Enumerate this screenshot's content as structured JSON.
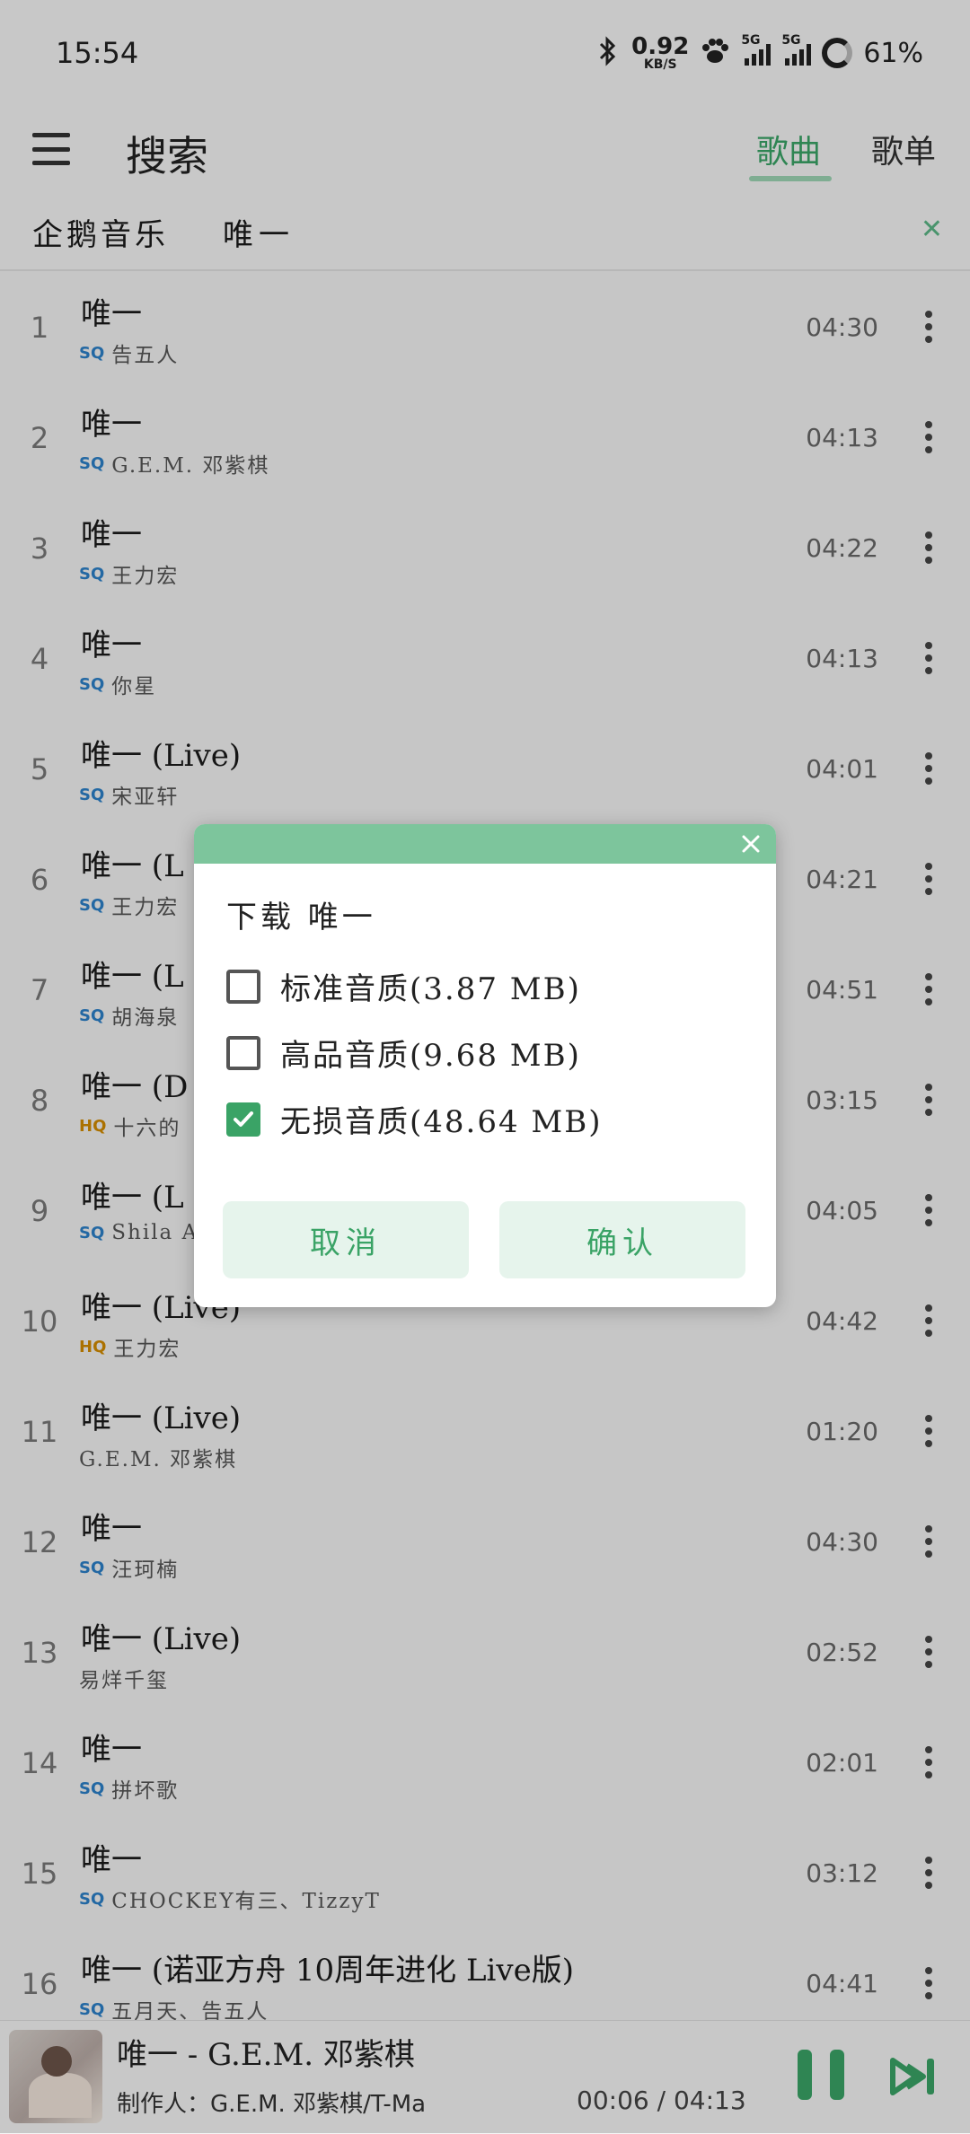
{
  "status_bar": {
    "time": "15:54",
    "net_speed_value": "0.92",
    "net_speed_unit": "KB/S",
    "signal1_label": "5G",
    "signal2_label": "5G",
    "battery": "61%"
  },
  "header": {
    "title": "搜索",
    "tabs": [
      {
        "label": "歌曲",
        "active": true
      },
      {
        "label": "歌单",
        "active": false
      }
    ]
  },
  "search": {
    "source": "企鹅音乐",
    "query": "唯一"
  },
  "songs": [
    {
      "index": "1",
      "title": "唯一",
      "badge": "SQ",
      "artist": "告五人",
      "duration": "04:30"
    },
    {
      "index": "2",
      "title": "唯一",
      "badge": "SQ",
      "artist": "G.E.M. 邓紫棋",
      "duration": "04:13"
    },
    {
      "index": "3",
      "title": "唯一",
      "badge": "SQ",
      "artist": "王力宏",
      "duration": "04:22"
    },
    {
      "index": "4",
      "title": "唯一",
      "badge": "SQ",
      "artist": "你星",
      "duration": "04:13"
    },
    {
      "index": "5",
      "title": "唯一 (Live)",
      "badge": "SQ",
      "artist": "宋亚轩",
      "duration": "04:01"
    },
    {
      "index": "6",
      "title": "唯一 (L",
      "badge": "SQ",
      "artist": "王力宏",
      "duration": "04:21"
    },
    {
      "index": "7",
      "title": "唯一 (L",
      "badge": "SQ",
      "artist": "胡海泉",
      "duration": "04:51"
    },
    {
      "index": "8",
      "title": "唯一 (D",
      "badge": "HQ",
      "artist": "十六的",
      "duration": "03:15"
    },
    {
      "index": "9",
      "title": "唯一 (L",
      "badge": "SQ",
      "artist": "Shila Am",
      "duration": "04:05"
    },
    {
      "index": "10",
      "title": "唯一 (Live)",
      "badge": "HQ",
      "artist": "王力宏",
      "duration": "04:42"
    },
    {
      "index": "11",
      "title": "唯一 (Live)",
      "badge": "",
      "artist": "G.E.M. 邓紫棋",
      "duration": "01:20"
    },
    {
      "index": "12",
      "title": "唯一",
      "badge": "SQ",
      "artist": "汪珂楠",
      "duration": "04:30"
    },
    {
      "index": "13",
      "title": "唯一 (Live)",
      "badge": "",
      "artist": "易烊千玺",
      "duration": "02:52"
    },
    {
      "index": "14",
      "title": "唯一",
      "badge": "SQ",
      "artist": "拼坏歌",
      "duration": "02:01"
    },
    {
      "index": "15",
      "title": "唯一",
      "badge": "SQ",
      "artist": "CHOCKEY有三、TizzyT",
      "duration": "03:12"
    },
    {
      "index": "16",
      "title": "唯一 (诺亚方舟 10周年进化 Live版)",
      "badge": "SQ",
      "artist": "五月天、告五人",
      "duration": "04:41"
    }
  ],
  "player": {
    "title": "唯一 - G.E.M. 邓紫棋",
    "credit": "制作人：G.E.M. 邓紫棋/T-Ma",
    "time_current": "00:06",
    "time_sep": "/",
    "time_total": "04:13"
  },
  "dialog": {
    "title": "下载 唯一",
    "options": [
      {
        "label": "标准音质(3.87 MB)",
        "checked": false
      },
      {
        "label": "高品音质(9.68 MB)",
        "checked": false
      },
      {
        "label": "无损音质(48.64 MB)",
        "checked": true
      }
    ],
    "cancel_label": "取消",
    "confirm_label": "确认"
  },
  "colors": {
    "accent": "#3aa366",
    "dialog_header": "#7dc59c",
    "sq_badge": "#2b7fc7",
    "hq_badge": "#d18a00"
  }
}
